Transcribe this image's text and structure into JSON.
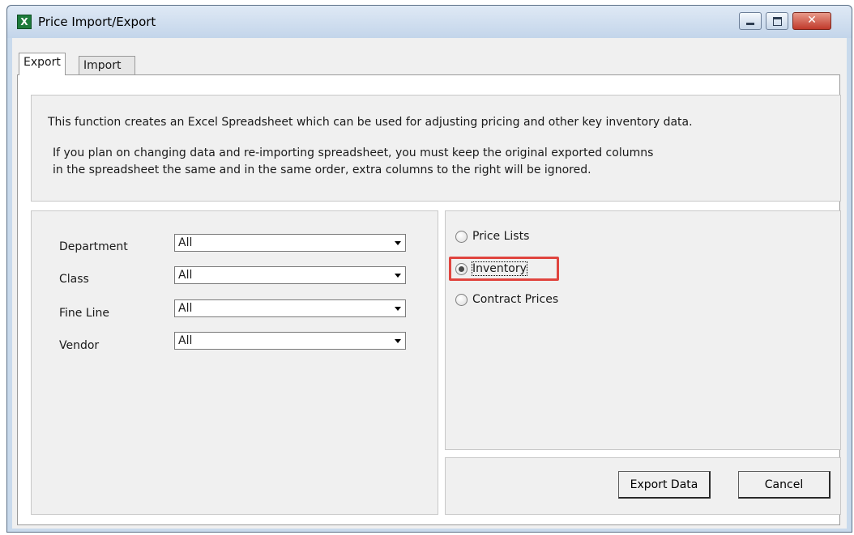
{
  "window": {
    "title": "Price Import/Export",
    "app_icon": "excel-icon",
    "controls": {
      "close": "✕"
    }
  },
  "tabs": [
    {
      "label": "Export",
      "selected": true
    },
    {
      "label": "Import",
      "selected": false
    }
  ],
  "info": {
    "line1": "This function creates an Excel Spreadsheet which can be used for adjusting pricing and other key inventory data.",
    "line2": "If you plan on changing data and re-importing spreadsheet, you must keep the original exported columns",
    "line3": "in the spreadsheet the same and in the same order,  extra columns to the right will be ignored."
  },
  "filters": [
    {
      "label": "Department",
      "value": "All"
    },
    {
      "label": "Class",
      "value": "All"
    },
    {
      "label": "Fine Line",
      "value": "All"
    },
    {
      "label": "Vendor",
      "value": "All"
    }
  ],
  "export_types": [
    {
      "label": "Price Lists",
      "checked": false
    },
    {
      "label": "Inventory",
      "checked": true
    },
    {
      "label": "Contract Prices",
      "checked": false
    }
  ],
  "buttons": {
    "export": "Export Data",
    "cancel": "Cancel"
  },
  "colors": {
    "highlight": "#e0443e"
  }
}
